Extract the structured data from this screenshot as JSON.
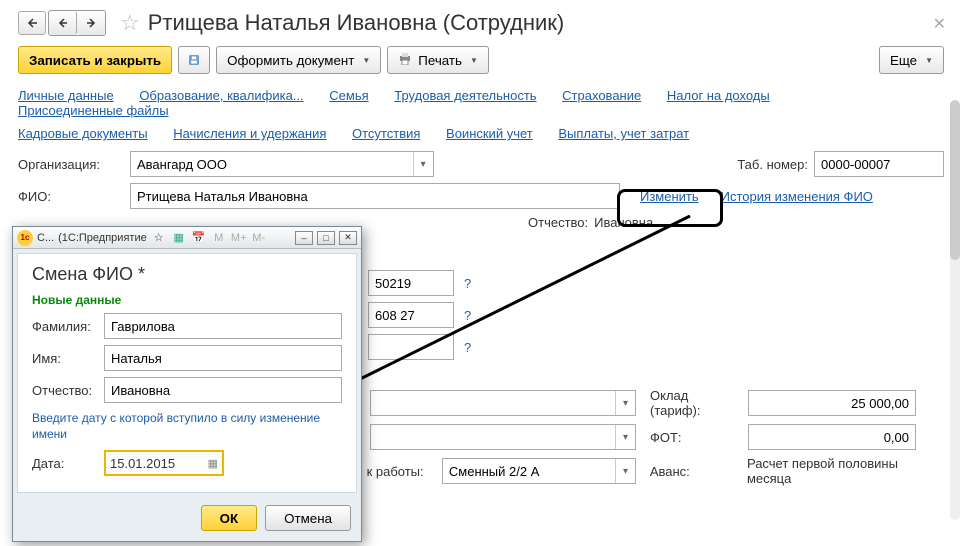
{
  "header": {
    "title": "Ртищева Наталья Ивановна (Сотрудник)"
  },
  "toolbar": {
    "save_close": "Записать и закрыть",
    "make_doc": "Оформить документ",
    "print": "Печать",
    "more": "Еще"
  },
  "tabs1": [
    "Личные данные",
    "Образование, квалифика...",
    "Семья",
    "Трудовая деятельность",
    "Страхование",
    "Налог на доходы",
    "Присоединенные файлы"
  ],
  "tabs2": [
    "Кадровые документы",
    "Начисления и удержания",
    "Отсутствия",
    "Воинский учет",
    "Выплаты, учет затрат"
  ],
  "labels": {
    "org": "Организация:",
    "tabnum": "Таб. номер:",
    "fio": "ФИО:",
    "change": "Изменить",
    "history": "История изменения ФИО",
    "patronymic_lbl": "Отчество:",
    "patronymic_val": "Ивановна",
    "schedule": "к работы:",
    "oklad": "Оклад (тариф):",
    "fot": "ФОТ:",
    "avans": "Аванс:",
    "avans_val": "Расчет первой половины месяца"
  },
  "values": {
    "org": "Авангард ООО",
    "tabnum": "0000-00007",
    "fio": "Ртищева Наталья Ивановна",
    "field1": "50219",
    "field2": "608 27",
    "schedule": "Сменный 2/2 А",
    "oklad": "25 000,00",
    "fot": "0,00"
  },
  "modal": {
    "titlebar_app": "(1С:Предприятие",
    "titlebar_short": "С...",
    "title": "Смена ФИО *",
    "section": "Новые данные",
    "surname_lbl": "Фамилия:",
    "surname": "Гаврилова",
    "name_lbl": "Имя:",
    "name": "Наталья",
    "patr_lbl": "Отчество:",
    "patr": "Ивановна",
    "hint": "Введите дату с которой вступило в силу изменение имени",
    "date_lbl": "Дата:",
    "date": "15.01.2015",
    "ok": "ОК",
    "cancel": "Отмена"
  }
}
